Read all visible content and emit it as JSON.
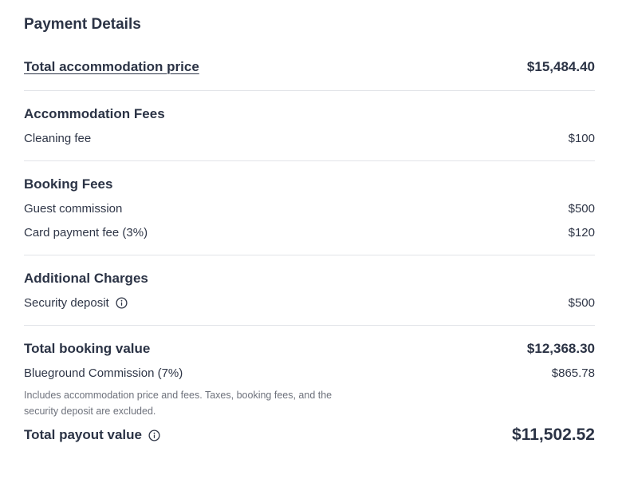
{
  "title": "Payment Details",
  "total_accommodation": {
    "label": "Total accommodation price",
    "value": "$15,484.40"
  },
  "accommodation_fees": {
    "heading": "Accommodation Fees",
    "items": [
      {
        "label": "Cleaning fee",
        "value": "$100"
      }
    ]
  },
  "booking_fees": {
    "heading": "Booking Fees",
    "items": [
      {
        "label": "Guest commission",
        "value": "$500"
      },
      {
        "label": "Card payment fee (3%)",
        "value": "$120"
      }
    ]
  },
  "additional_charges": {
    "heading": "Additional Charges",
    "items": [
      {
        "label": "Security deposit",
        "value": "$500",
        "icon": "info-icon"
      }
    ]
  },
  "total_booking": {
    "label": "Total booking value",
    "value": "$12,368.30"
  },
  "commission": {
    "label": "Blueground Commission (7%)",
    "value": "$865.78",
    "note": "Includes accommodation price and fees. Taxes, booking fees, and the security deposit are excluded."
  },
  "total_payout": {
    "label": "Total payout value",
    "value": "$11,502.52",
    "icon": "info-icon"
  },
  "colors": {
    "text": "#2b3345",
    "muted": "#6e727c",
    "divider": "#e2e4e8",
    "background": "#ffffff"
  }
}
